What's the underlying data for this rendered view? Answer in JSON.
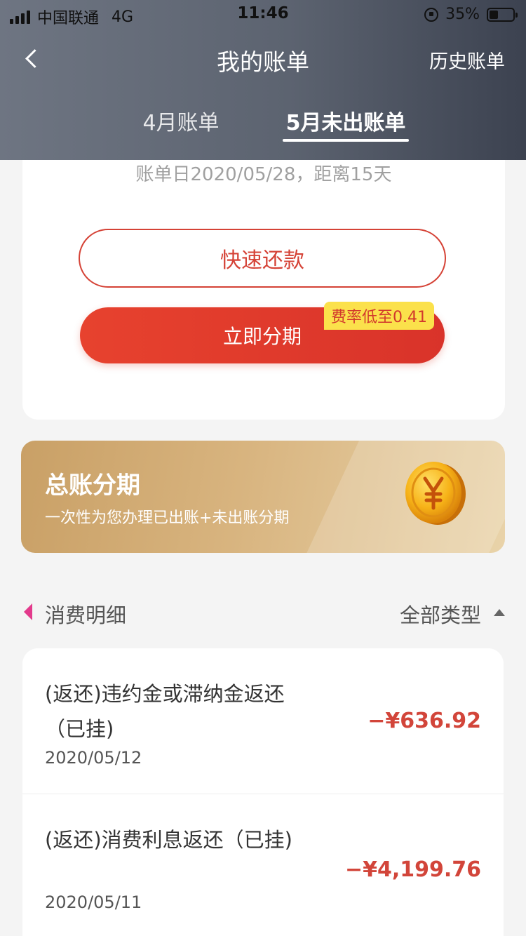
{
  "status_bar": {
    "carrier": "中国联通",
    "network": "4G",
    "time": "11:46",
    "battery": "35%"
  },
  "nav": {
    "title": "我的账单",
    "right_label": "历史账单"
  },
  "tabs": [
    {
      "label": "4月账单",
      "active": false
    },
    {
      "label": "5月未出账单",
      "active": true
    }
  ],
  "bill": {
    "date_text": "账单日2020/05/28，距离15天",
    "quick_repay_label": "快速还款",
    "installment_label": "立即分期",
    "rate_badge": "费率低至0.41"
  },
  "promo": {
    "title": "总账分期",
    "subtitle": "一次性为您办理已出账+未出账分期"
  },
  "section": {
    "title": "消费明细",
    "filter_label": "全部类型"
  },
  "transactions": [
    {
      "description": "(返还)违约金或滞纳金返还（已挂)",
      "date": "2020/05/12",
      "amount": "−¥636.92"
    },
    {
      "description": "(返还)消费利息返还（已挂)",
      "date": "2020/05/11",
      "amount": "−¥4,199.76"
    }
  ],
  "colors": {
    "accent_red": "#d54236",
    "badge_yellow": "#fbe14b",
    "marker_pink": "#e33a8c",
    "promo_gold": "#d8b47f"
  }
}
